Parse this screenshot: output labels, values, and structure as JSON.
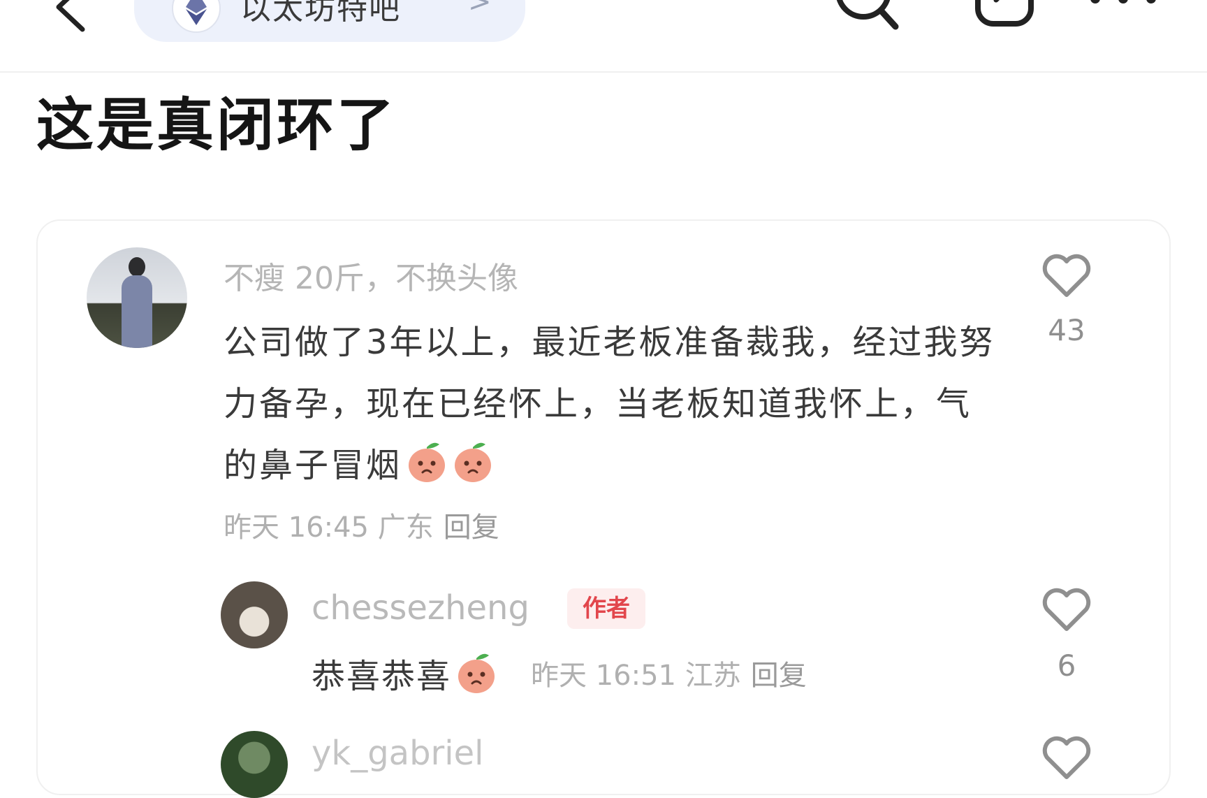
{
  "header": {
    "back_icon": "chevron-left-icon",
    "topic_icon": "ethereum-logo-icon",
    "topic_label": "以太坊特吧",
    "topic_chevron": ">",
    "search_icon": "search-icon",
    "share_icon": "share-icon",
    "more_icon": "more-dots-icon"
  },
  "post": {
    "title": "这是真闭环了"
  },
  "comment": {
    "author": "不瘦 20斤，不换头像",
    "body": "公司做了3年以上，最近老板准备裁我，经过我努力备孕，现在已经怀上，当老板知道我怀上，气的鼻子冒烟",
    "emojis": [
      "peach-face-emoji",
      "peach-face-emoji"
    ],
    "meta": "昨天 16:45 广东",
    "reply_label": "回复",
    "like_count": "43"
  },
  "reply": {
    "author": "chessezheng",
    "badge": "作者",
    "body": "恭喜恭喜",
    "emoji": "peach-face-emoji",
    "meta": "昨天 16:51 江苏",
    "reply_label": "回复",
    "like_count": "6"
  },
  "next_reply": {
    "author": "yk_gabriel"
  },
  "colors": {
    "accent_pill": "#edf1fb",
    "author_badge_bg": "#fdeeee",
    "author_badge_text": "#e2464c"
  }
}
